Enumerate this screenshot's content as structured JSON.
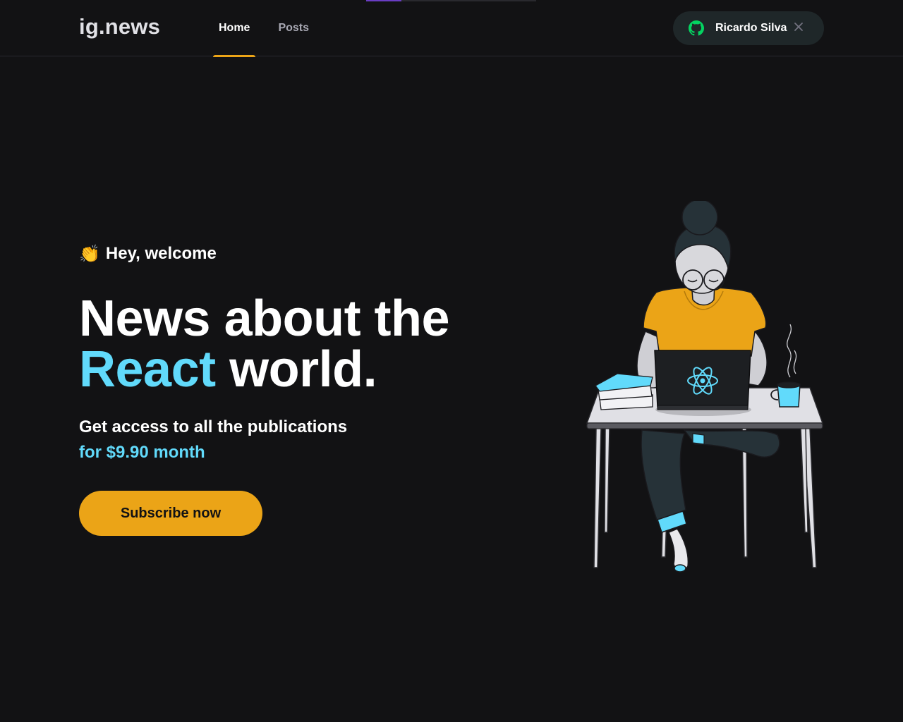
{
  "header": {
    "logo": "ig.news",
    "nav": [
      {
        "label": "Home",
        "active": true
      },
      {
        "label": "Posts",
        "active": false
      }
    ],
    "user": {
      "name": "Ricardo Silva",
      "icon": "github-icon",
      "close_icon": "close-icon"
    }
  },
  "hero": {
    "welcome_emoji": "👏",
    "welcome": "Hey, welcome",
    "title_line1": "News about the",
    "title_highlight": "React",
    "title_line2_rest": " world.",
    "subtitle": "Get access to all the publications",
    "price_text": "for $9.90 month",
    "cta_label": "Subscribe now"
  },
  "colors": {
    "background": "#121214",
    "accent_yellow": "#eba417",
    "react_cyan": "#61dafb",
    "github_green": "#04d361"
  }
}
